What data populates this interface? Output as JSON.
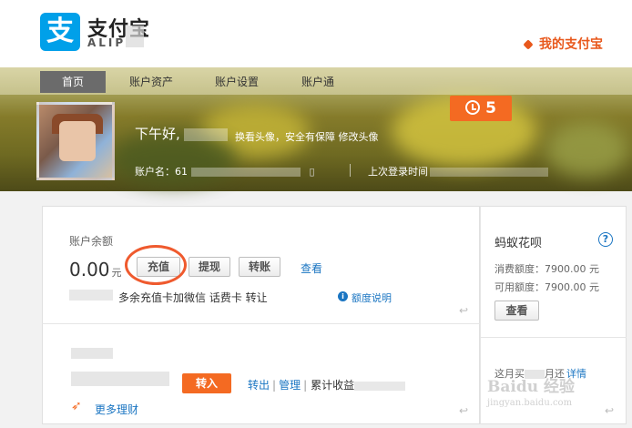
{
  "header": {
    "logo_mark": "支",
    "logo_text": "支付宝",
    "logo_en": "ALIP",
    "my_alipay": "我的支付宝"
  },
  "nav": {
    "items": [
      {
        "label": "首页",
        "active": true
      },
      {
        "label": "账户资产",
        "active": false
      },
      {
        "label": "账户设置",
        "active": false
      },
      {
        "label": "账户通",
        "active": false
      }
    ]
  },
  "profile": {
    "greeting": "下午好,",
    "avatar_links": "换看头像，安全有保障 修改头像",
    "account_label": "账户名：",
    "account_prefix": "61",
    "last_login_label": "上次登录时间",
    "alarm_count": "5"
  },
  "balance": {
    "label": "账户余额",
    "amount": "0.00",
    "unit": "元",
    "buttons": {
      "recharge": "充值",
      "withdraw": "提现",
      "transfer": "转账"
    },
    "view_link": "查看",
    "promo_text": "多余充值卡加微信 话费卡 转让",
    "quota_link": "额度说明",
    "enter_glyph": "↩"
  },
  "yuebao": {
    "transfer_in": "转入",
    "transfer_out": "转出",
    "manage": "管理",
    "separator": "|",
    "accumulated": "累计收益",
    "more_finance": "更多理财",
    "enter_glyph": "↩"
  },
  "huabei": {
    "title": "蚂蚁花呗",
    "help": "?",
    "consume_quota": "消费额度：7900.00 元",
    "available_quota": "可用额度：7900.00 元",
    "check_button": "查看",
    "month_text_1": "这月买",
    "month_text_2": "月还",
    "detail_link": "详情",
    "enter_glyph": "↩"
  },
  "watermark": {
    "main": "Baidu 经验",
    "sub": "jingyan.baidu.com"
  },
  "colors": {
    "brand_blue": "#00a0e9",
    "accent_orange": "#f46a22",
    "link_blue": "#1a75c2",
    "highlight_circle": "#ef5a2e"
  }
}
